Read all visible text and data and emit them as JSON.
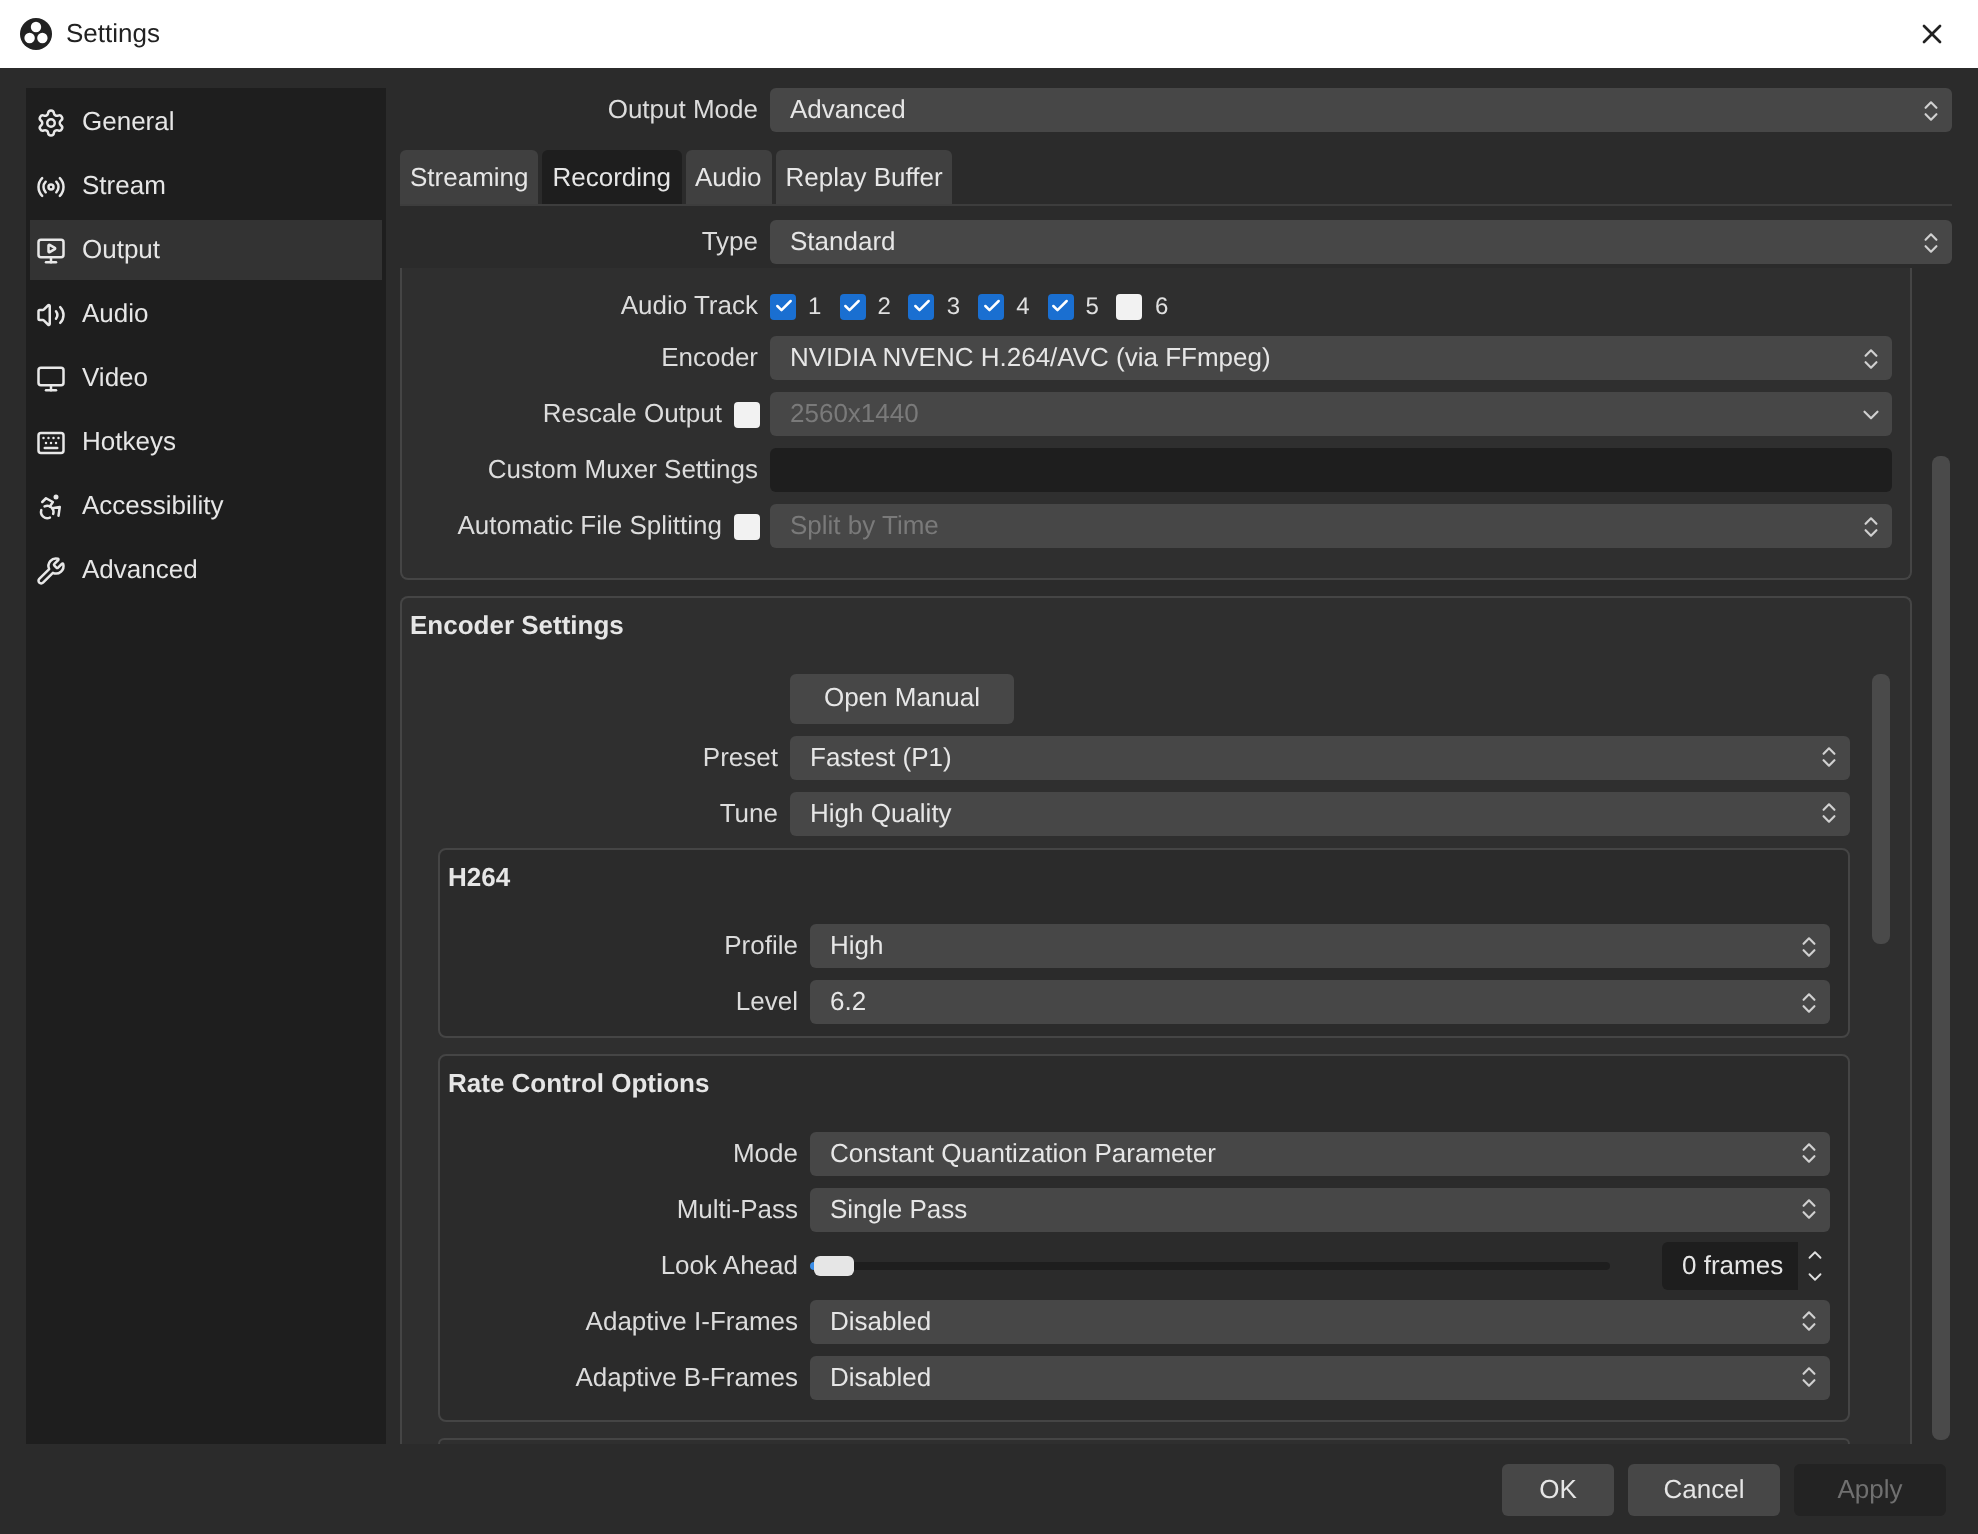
{
  "window": {
    "title": "Settings"
  },
  "sidebar": {
    "items": [
      {
        "label": "General",
        "selected": false
      },
      {
        "label": "Stream",
        "selected": false
      },
      {
        "label": "Output",
        "selected": true
      },
      {
        "label": "Audio",
        "selected": false
      },
      {
        "label": "Video",
        "selected": false
      },
      {
        "label": "Hotkeys",
        "selected": false
      },
      {
        "label": "Accessibility",
        "selected": false
      },
      {
        "label": "Advanced",
        "selected": false
      }
    ]
  },
  "output_mode": {
    "label": "Output Mode",
    "value": "Advanced"
  },
  "tabs": [
    {
      "label": "Streaming",
      "selected": false
    },
    {
      "label": "Recording",
      "selected": true
    },
    {
      "label": "Audio",
      "selected": false
    },
    {
      "label": "Replay Buffer",
      "selected": false
    }
  ],
  "type": {
    "label": "Type",
    "value": "Standard"
  },
  "recording": {
    "audio_track": {
      "label": "Audio Track",
      "tracks": [
        {
          "label": "1",
          "checked": true
        },
        {
          "label": "2",
          "checked": true
        },
        {
          "label": "3",
          "checked": true
        },
        {
          "label": "4",
          "checked": true
        },
        {
          "label": "5",
          "checked": true
        },
        {
          "label": "6",
          "checked": false
        }
      ]
    },
    "encoder": {
      "label": "Encoder",
      "value": "NVIDIA NVENC H.264/AVC (via FFmpeg)"
    },
    "rescale_output": {
      "label": "Rescale Output",
      "checked": false,
      "value": "2560x1440"
    },
    "custom_muxer": {
      "label": "Custom Muxer Settings"
    },
    "file_splitting": {
      "label": "Automatic File Splitting",
      "checked": false,
      "value": "Split by Time"
    }
  },
  "encoder_settings": {
    "title": "Encoder Settings",
    "open_manual": "Open Manual",
    "preset": {
      "label": "Preset",
      "value": "Fastest (P1)"
    },
    "tune": {
      "label": "Tune",
      "value": "High Quality"
    },
    "h264": {
      "title": "H264",
      "profile": {
        "label": "Profile",
        "value": "High"
      },
      "level": {
        "label": "Level",
        "value": "6.2"
      }
    },
    "rate_control": {
      "title": "Rate Control Options",
      "fields": [
        {
          "kind": "select",
          "label": "Mode",
          "value": "Constant Quantization Parameter"
        },
        {
          "kind": "select",
          "label": "Multi-Pass",
          "value": "Single Pass"
        },
        {
          "kind": "slider",
          "label": "Look Ahead",
          "level": 0,
          "value": "0 frames"
        },
        {
          "kind": "select",
          "label": "Adaptive I-Frames",
          "value": "Disabled"
        },
        {
          "kind": "select",
          "label": "Adaptive B-Frames",
          "value": "Disabled"
        }
      ]
    }
  },
  "buttons": [
    {
      "label": "OK",
      "disabled": false
    },
    {
      "label": "Cancel",
      "disabled": false
    },
    {
      "label": "Apply",
      "disabled": true
    }
  ]
}
